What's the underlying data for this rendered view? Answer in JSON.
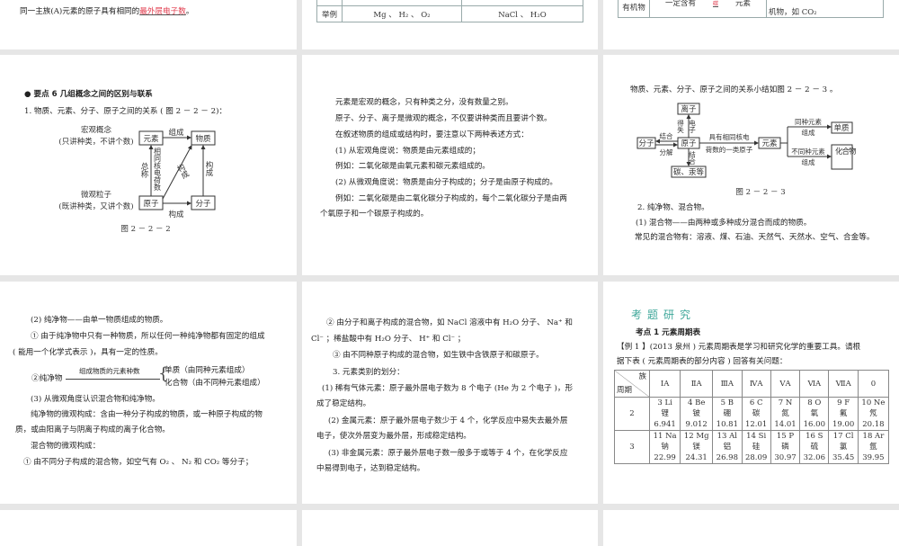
{
  "slides": {
    "s1": {
      "line": "同一主族(A)元素的原子具有相同的",
      "answer": "最外层电子数",
      "end": "。"
    },
    "s2": {
      "row_label": "举例",
      "ex1": "Mg 、 H₂ 、 O₂",
      "ex2": "NaCl 、 H₂O"
    },
    "s3": {
      "row_label": "有机物",
      "cell_pre": "一定含有",
      "answer": "碳",
      "cell_post": "元素",
      "cell2": "机物，如  CO₂"
    },
    "s4": {
      "heading": "● 要点  6   几组概念之间的区别与联系",
      "line1": "1. 物质、元素、分子、原子之间的关系 ( 图  2 － 2 － 2)：",
      "macro": "宏观概念",
      "macro_note": "(只讲种类，不讲个数)",
      "micro": "微观粒子",
      "micro_note": "(既讲种类，又讲个数)",
      "box_element": "元素",
      "box_matter": "物质",
      "box_atom": "原子",
      "box_molecule": "分子",
      "lbl_compose": "组成",
      "lbl_total": "总称",
      "lbl_same": "相同核电荷数",
      "lbl_constitute": "构成",
      "caption": "图  2 － 2 － 2"
    },
    "s5": {
      "lines": [
        "元素是宏观的概念，只有种类之分，没有数量之别。",
        "原子、分子、离子是微观的概念，不仅要讲种类而且要讲个数。",
        "在叙述物质的组成或结构时，要注意以下两种表述方式：",
        "(1) 从宏观角度说：物质是由元素组成的；",
        "例如：二氧化碳是由氧元素和碳元素组成的。",
        "(2) 从微观角度说：物质是由分子构成的；分子是由原子构成的。",
        "例如：二氧化碳是由二氧化碳分子构成的，每个二氧化碳分子是由两",
        "个氧原子和一个碳原子构成的。"
      ]
    },
    "s6": {
      "intro": "物质、元素、分子、原子之间的关系小结如图  2 － 2 － 3 。",
      "ion": "离子",
      "molecule": "分子",
      "atom": "原子",
      "carbon": "碳、汞等",
      "element": "元素",
      "simple": "单质",
      "compound": "化合物",
      "gain_lose": "得失",
      "electron": "电子",
      "combine": "结合",
      "decompose": "分解",
      "combine2": "结合",
      "same_nuclear1": "具有相同核电",
      "same_nuclear2": "荷数的一类原子",
      "same_el": "同种元素",
      "diff_el": "不同种元素",
      "compose": "组成",
      "caption": "图  2 － 2 － 3",
      "line2": "2. 纯净物、混合物。",
      "line3": "(1) 混合物——由两种或多种成分混合而成的物质。",
      "line4": "常见的混合物有：溶液、煤、石油、天然气、天然水、空气、合金等。"
    },
    "s7": {
      "l1": "(2) 纯净物——由单一物质组成的物质。",
      "l2": "① 由于纯净物中只有一种物质，所以任何一种纯净物都有固定的组成",
      "l3": "( 能用一个化学式表示 )，具有一定的性质。",
      "pure": "②纯净物",
      "arrow_label": "组成物质的元素种数",
      "simple": "单质（由同种元素组成）",
      "compound": "化合物（由不同种元素组成）",
      "l4": "(3) 从微观角度认识混合物和纯净物。",
      "l5": "纯净物的微观构成：含由一种分子构成的物质，或一种原子构成的物",
      "l6": "质，或由阳离子与阴离子构成的离子化合物。",
      "l7": "混合物的微观构成：",
      "l8": "① 由不同分子构成的混合物，如空气有  O₂ 、 N₂ 和  CO₂ 等分子；"
    },
    "s8": {
      "lines": [
        "② 由分子和离子构成的混合物，如 NaCl 溶液中有 H₂O 分子、 Na⁺ 和",
        "Cl⁻ ；稀盐酸中有 H₂O 分子、 H⁺ 和 Cl⁻ ；",
        "③ 由不同种原子构成的混合物，如生铁中含铁原子和碳原子。",
        "3. 元素类别的划分：",
        "(1) 稀有气体元素：原子最外层电子数为  8  个电子 (He  为  2  个电子 )，形",
        "成了稳定结构。",
        "(2) 金属元素：原子最外层电子数少于  4  个，化学反应中易失去最外层",
        "电子，使次外层变为最外层，形成稳定结构。",
        "(3) 非金属元素：原子最外层电子数一般多于或等于  4  个，在化学反应",
        "中易得到电子，达到稳定结构。"
      ]
    },
    "s9": {
      "section": "考题研究",
      "point": "考点  1      元素周期表",
      "ex1": "【例  1 】(2013  泉州 ) 元素周期表是学习和研究化学的重要工具。请根",
      "ex2": "据下表 ( 元素周期表的部分内容 ) 回答有关问题：",
      "corner_group": "族",
      "corner_period": "周期",
      "groups": [
        "ⅠA",
        "ⅡA",
        "ⅢA",
        "ⅣA",
        "ⅤA",
        "ⅥA",
        "ⅦA",
        "0"
      ],
      "rows": [
        {
          "period": "2",
          "cells": [
            [
              "3  Li",
              "锂",
              "6.941"
            ],
            [
              "4  Be",
              "铍",
              "9.012"
            ],
            [
              "5  B",
              "硼",
              "10.81"
            ],
            [
              "6  C",
              "碳",
              "12.01"
            ],
            [
              "7  N",
              "氮",
              "14.01"
            ],
            [
              "8  O",
              "氧",
              "16.00"
            ],
            [
              "9  F",
              "氟",
              "19.00"
            ],
            [
              "10  Ne",
              "氖",
              "20.18"
            ]
          ]
        },
        {
          "period": "3",
          "cells": [
            [
              "11  Na",
              "钠",
              "22.99"
            ],
            [
              "12  Mg",
              "镁",
              "24.31"
            ],
            [
              "13  Al",
              "铝",
              "26.98"
            ],
            [
              "14  Si",
              "硅",
              "28.09"
            ],
            [
              "15  P",
              "磷",
              "30.97"
            ],
            [
              "16  S",
              "硫",
              "32.06"
            ],
            [
              "17  Cl",
              "氯",
              "35.45"
            ],
            [
              "18  Ar",
              "氩",
              "39.95"
            ]
          ]
        }
      ]
    }
  }
}
